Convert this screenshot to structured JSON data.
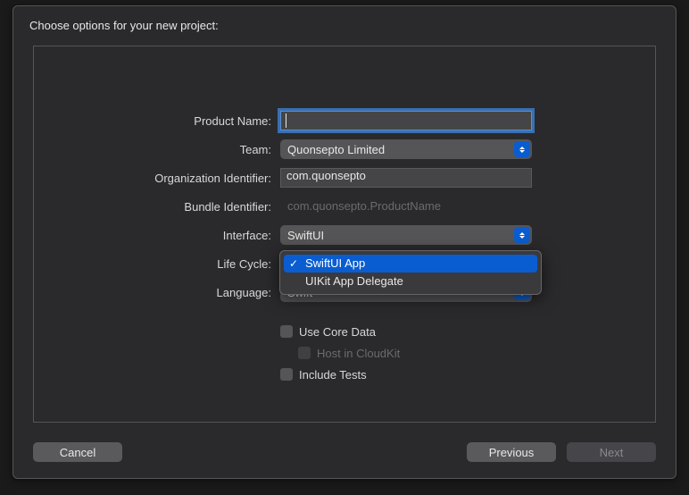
{
  "dialog": {
    "title": "Choose options for your new project:"
  },
  "form": {
    "product_name": {
      "label": "Product Name:",
      "value": ""
    },
    "team": {
      "label": "Team:",
      "value": "Quonsepto Limited"
    },
    "org_id": {
      "label": "Organization Identifier:",
      "value": "com.quonsepto"
    },
    "bundle_id": {
      "label": "Bundle Identifier:",
      "value": "com.quonsepto.ProductName"
    },
    "interface": {
      "label": "Interface:",
      "value": "SwiftUI"
    },
    "life_cycle": {
      "label": "Life Cycle:",
      "value": "SwiftUI App"
    },
    "language": {
      "label": "Language:",
      "value": "Swift"
    },
    "use_core_data": {
      "label": "Use Core Data",
      "checked": false
    },
    "host_cloudkit": {
      "label": "Host in CloudKit",
      "checked": false,
      "disabled": true
    },
    "include_tests": {
      "label": "Include Tests",
      "checked": false
    }
  },
  "life_cycle_menu": {
    "items": [
      "SwiftUI App",
      "UIKit App Delegate"
    ],
    "selected_index": 0
  },
  "footer": {
    "cancel": "Cancel",
    "previous": "Previous",
    "next": "Next"
  }
}
